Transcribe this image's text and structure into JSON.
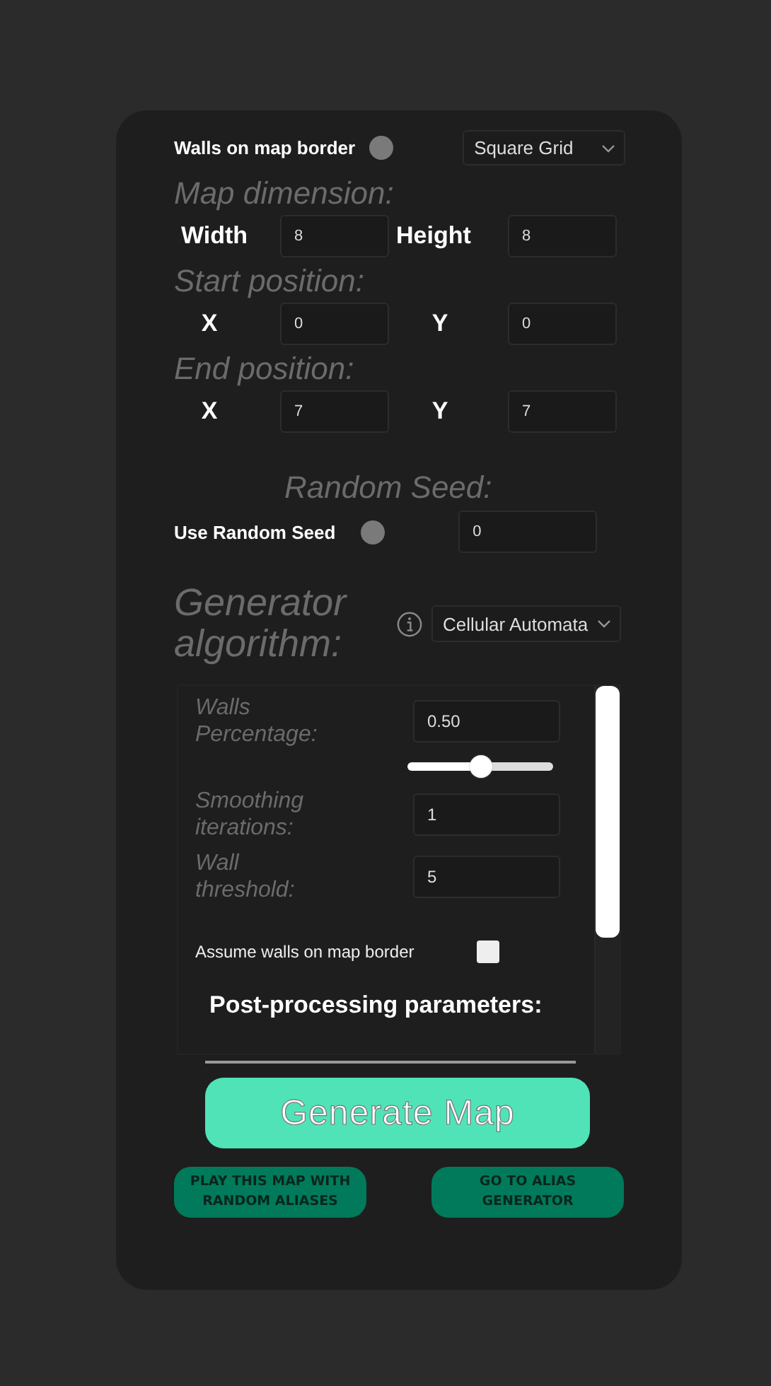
{
  "walls_on_border": {
    "label": "Walls on map border",
    "on": false
  },
  "grid_type": {
    "value": "Square Grid"
  },
  "sections": [
    {
      "title": "Map dimension:",
      "kind": "dimension",
      "fields": [
        {
          "label": "Width",
          "value": "8"
        },
        {
          "label": "Height",
          "value": "8"
        }
      ]
    },
    {
      "title": "Start position:",
      "kind": "position",
      "fields": [
        {
          "label": "X",
          "value": "0"
        },
        {
          "label": "Y",
          "value": "0"
        }
      ]
    },
    {
      "title": "End position:",
      "kind": "position",
      "fields": [
        {
          "label": "X",
          "value": "7"
        },
        {
          "label": "Y",
          "value": "7"
        }
      ]
    }
  ],
  "random_seed": {
    "title": "Random Seed:",
    "label": "Use Random Seed",
    "on": false,
    "value": "0"
  },
  "generator": {
    "title": "Generator algorithm:",
    "algorithm": "Cellular Automata"
  },
  "parameters": [
    {
      "kind": "number",
      "label": "Walls Percentage:",
      "value": "0.50"
    },
    {
      "kind": "slider",
      "level": 0.5
    },
    {
      "kind": "number",
      "label": "Smoothing iterations:",
      "value": "1"
    },
    {
      "kind": "number",
      "label": "Wall threshold:",
      "value": "5"
    },
    {
      "kind": "checkbox",
      "label": "Assume walls on map border",
      "checked": false
    },
    {
      "kind": "heading",
      "label": "Post-processing parameters:"
    }
  ],
  "generate_button": "Generate Map",
  "secondary_buttons": [
    "PLAY THIS MAP WITH RANDOM ALIASES",
    "GO TO ALIAS GENERATOR"
  ]
}
